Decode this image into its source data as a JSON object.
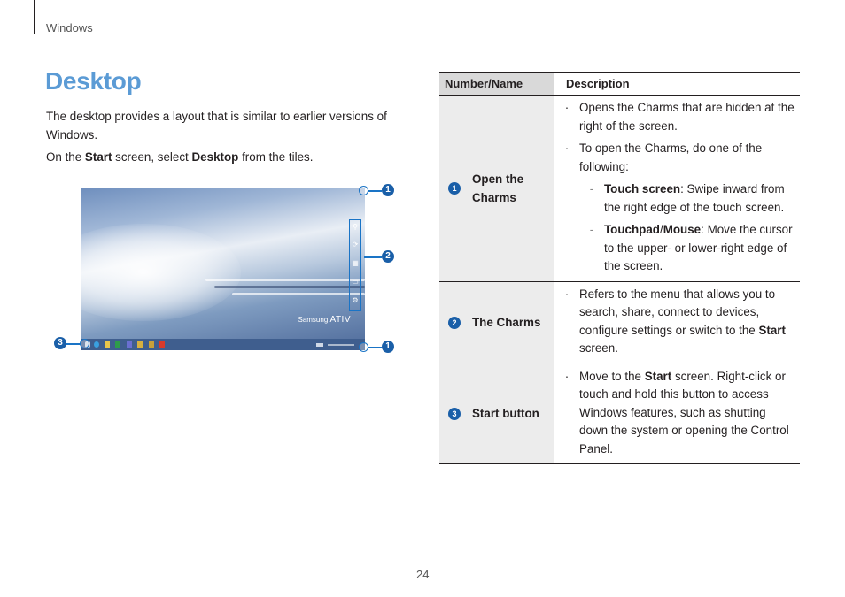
{
  "header": {
    "section": "Windows"
  },
  "title": "Desktop",
  "intro": {
    "p1": "The desktop provides a layout that is similar to earlier versions of Windows.",
    "p2_pre": "On the ",
    "p2_b1": "Start",
    "p2_mid": " screen, select ",
    "p2_b2": "Desktop",
    "p2_post": " from the tiles."
  },
  "screenshot": {
    "brand_1": "Samsung",
    "brand_2": "ATIV",
    "callouts": [
      "1",
      "2",
      "3",
      "1"
    ],
    "charms": [
      "search-icon",
      "share-icon",
      "start-icon",
      "devices-icon",
      "settings-icon"
    ],
    "taskbar_icons": [
      "ie-icon",
      "folder-icon",
      "excel-icon",
      "word-icon",
      "app-icon",
      "app-icon",
      "office-icon"
    ]
  },
  "table": {
    "headers": [
      "Number/Name",
      "Description"
    ],
    "rows": [
      {
        "num": "1",
        "name": "Open the Charms",
        "bullets": [
          "Opens the Charms that are hidden at the right of the screen.",
          "To open the Charms, do one of the following:"
        ],
        "subs": [
          {
            "bold": "Touch screen",
            "text": ": Swipe inward from the right edge of the touch screen."
          },
          {
            "bold": "Touchpad",
            "sep": "/",
            "bold2": "Mouse",
            "text": ": Move the cursor to the upper- or lower-right edge of the screen."
          }
        ]
      },
      {
        "num": "2",
        "name": "The Charms",
        "text": "Refers to the menu that allows you to search, share, connect to devices, configure settings or switch to the ",
        "bold": "Start",
        "text2": " screen."
      },
      {
        "num": "3",
        "name": "Start button",
        "text": "Move to the ",
        "bold": "Start",
        "text2": " screen. Right-click or touch and hold this button to access Windows features, such as shutting down the system or opening the Control Panel."
      }
    ]
  },
  "page_number": "24",
  "colors": {
    "accent": "#5b9bd5",
    "callout": "#1a5fa8",
    "header_bg": "#d9d9d9",
    "name_bg": "#ececec"
  }
}
